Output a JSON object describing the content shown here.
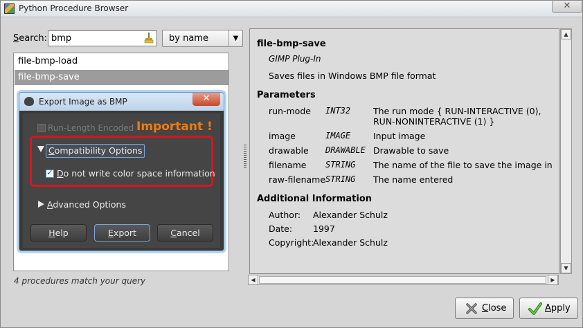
{
  "window": {
    "title": "Python Procedure Browser",
    "close": "✕"
  },
  "search": {
    "label_prefix": "",
    "label_mnemonic": "S",
    "label_rest": "earch:",
    "value": "bmp",
    "clear_icon": "broom-icon",
    "mode": "by name"
  },
  "procedures": {
    "items": [
      {
        "label": "file-bmp-load"
      },
      {
        "label": "file-bmp-save"
      }
    ],
    "match_text": "4 procedures match your query"
  },
  "info": {
    "name": "file-bmp-save",
    "type": "GIMP Plug-In",
    "description": "Saves files in Windows BMP file format",
    "parameters_heading": "Parameters",
    "parameters": [
      {
        "name": "run-mode",
        "type": "INT32",
        "desc": "The run mode { RUN-INTERACTIVE (0), RUN-NONINTERACTIVE (1) }"
      },
      {
        "name": "image",
        "type": "IMAGE",
        "desc": "Input image"
      },
      {
        "name": "drawable",
        "type": "DRAWABLE",
        "desc": "Drawable to save"
      },
      {
        "name": "filename",
        "type": "STRING",
        "desc": "The name of the file to save the image in"
      },
      {
        "name": "raw-filename",
        "type": "STRING",
        "desc": "The name entered"
      }
    ],
    "additional_heading": "Additional Information",
    "additional": [
      {
        "key": "Author:",
        "value": "Alexander Schulz"
      },
      {
        "key": "Date:",
        "value": "1997"
      },
      {
        "key": "Copyright:",
        "value": "Alexander Schulz"
      }
    ]
  },
  "buttons": {
    "close_mnemonic": "C",
    "close_rest": "lose",
    "apply_mnemonic": "A",
    "apply_rest": "pply"
  },
  "dialog": {
    "title": "Export Image as BMP",
    "close": "✕",
    "run_length": "Run-Length Encoded",
    "annotation": "Important !",
    "compat_mnemonic": "C",
    "compat_rest": "ompatibility Options",
    "color_space_mnemonic": "D",
    "color_space_rest": "o not write color space information",
    "color_space_checked": true,
    "advanced_mnemonic": "A",
    "advanced_rest": "dvanced Options",
    "help_mnemonic": "H",
    "help_rest": "elp",
    "export_mnemonic": "E",
    "export_rest": "xport",
    "cancel_mnemonic": "C",
    "cancel_rest": "ancel"
  }
}
